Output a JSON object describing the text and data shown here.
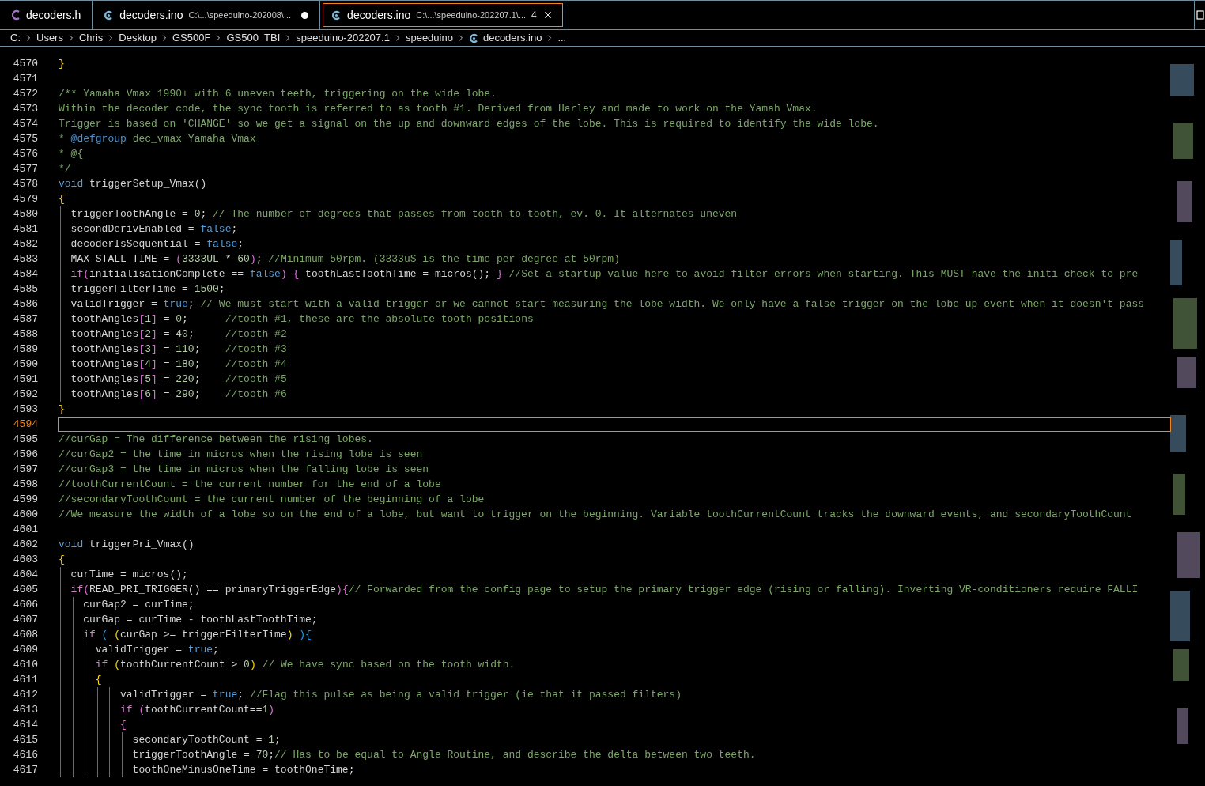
{
  "tabs": [
    {
      "filename": "decoders.h",
      "kind": "header",
      "modified": false,
      "selected": false
    },
    {
      "filename": "decoders.ino",
      "path": "C:\\...\\speeduino-202008\\...",
      "kind": "source",
      "modified": true,
      "selected": false
    },
    {
      "filename": "decoders.ino",
      "path": "C:\\...\\speeduino-202207.1\\...",
      "kind": "source",
      "badge": "4",
      "modified": false,
      "selected": true
    }
  ],
  "breadcrumb": [
    {
      "label": "C:"
    },
    {
      "label": "Users"
    },
    {
      "label": "Chris"
    },
    {
      "label": "Desktop"
    },
    {
      "label": "GS500F"
    },
    {
      "label": "GS500_TBI"
    },
    {
      "label": "speeduino-202207.1"
    },
    {
      "label": "speeduino"
    },
    {
      "label": "decoders.ino",
      "kind": "file"
    },
    {
      "label": "..."
    }
  ],
  "lines": [
    {
      "number": "4570",
      "current": false,
      "tokens": [
        {
          "kind": "bracket1",
          "text": "}"
        }
      ]
    },
    {
      "number": "4571",
      "current": false
    },
    {
      "number": "4572",
      "current": false,
      "tokens": [
        {
          "kind": "comment",
          "text": "/** Yamaha Vmax 1990+ with 6 uneven teeth, triggering on the wide lobe."
        }
      ]
    },
    {
      "number": "4573",
      "current": false,
      "tokens": [
        {
          "kind": "comment",
          "text": "Within the decoder code, the sync tooth is referred to as tooth #1. Derived from Harley and made to work on the Yamah Vmax."
        }
      ]
    },
    {
      "number": "4574",
      "current": false,
      "tokens": [
        {
          "kind": "comment",
          "text": "Trigger is based on 'CHANGE' so we get a signal on the up and downward edges of the lobe. This is required to identify the wide lobe."
        }
      ]
    },
    {
      "number": "4575",
      "current": false,
      "tokens": [
        {
          "kind": "comment",
          "text": "* "
        },
        {
          "kind": "tag",
          "text": "@defgroup"
        },
        {
          "kind": "comment",
          "text": " dec_vmax Yamaha Vmax"
        }
      ]
    },
    {
      "number": "4576",
      "current": false,
      "tokens": [
        {
          "kind": "comment",
          "text": "* @{"
        }
      ]
    },
    {
      "number": "4577",
      "current": false,
      "tokens": [
        {
          "kind": "comment",
          "text": "*/"
        }
      ]
    },
    {
      "number": "4578",
      "current": false,
      "tokens": [
        {
          "kind": "keyword",
          "text": "void"
        },
        {
          "kind": "plain",
          "text": " triggerSetup_Vmax()"
        }
      ]
    },
    {
      "number": "4579",
      "current": false,
      "tokens": [
        {
          "kind": "bracket1",
          "text": "{"
        }
      ]
    },
    {
      "number": "4580",
      "current": false,
      "tokens": [
        {
          "kind": "plain",
          "text": "  triggerToothAngle = "
        },
        {
          "kind": "number",
          "text": "0"
        },
        {
          "kind": "plain",
          "text": "; "
        },
        {
          "kind": "comment",
          "text": "// The number of degrees that passes from tooth to tooth, ev. 0. It alternates uneven"
        }
      ]
    },
    {
      "number": "4581",
      "current": false,
      "tokens": [
        {
          "kind": "plain",
          "text": "  secondDerivEnabled = "
        },
        {
          "kind": "keyword",
          "text": "false"
        },
        {
          "kind": "plain",
          "text": ";"
        }
      ]
    },
    {
      "number": "4582",
      "current": false,
      "tokens": [
        {
          "kind": "plain",
          "text": "  decoderIsSequential = "
        },
        {
          "kind": "keyword",
          "text": "false"
        },
        {
          "kind": "plain",
          "text": ";"
        }
      ]
    },
    {
      "number": "4583",
      "current": false,
      "tokens": [
        {
          "kind": "plain",
          "text": "  MAX_STALL_TIME = "
        },
        {
          "kind": "bracket2",
          "text": "("
        },
        {
          "kind": "number",
          "text": "3333UL"
        },
        {
          "kind": "plain",
          "text": " * "
        },
        {
          "kind": "number",
          "text": "60"
        },
        {
          "kind": "bracket2",
          "text": ")"
        },
        {
          "kind": "plain",
          "text": "; "
        },
        {
          "kind": "comment",
          "text": "//Minimum 50rpm. (3333uS is the time per degree at 50rpm)"
        }
      ]
    },
    {
      "number": "4584",
      "current": false,
      "tokens": [
        {
          "kind": "control",
          "text": "  if"
        },
        {
          "kind": "bracket2",
          "text": "("
        },
        {
          "kind": "plain",
          "text": "initialisationComplete == "
        },
        {
          "kind": "keyword",
          "text": "false"
        },
        {
          "kind": "bracket2",
          "text": ") {"
        },
        {
          "kind": "plain",
          "text": " toothLastToothTime = micros(); "
        },
        {
          "kind": "bracket2",
          "text": "} "
        },
        {
          "kind": "comment",
          "text": "//Set a startup value here to avoid filter errors when starting. This MUST have the initi check to pre"
        }
      ]
    },
    {
      "number": "4585",
      "current": false,
      "tokens": [
        {
          "kind": "plain",
          "text": "  triggerFilterTime = "
        },
        {
          "kind": "number",
          "text": "1500"
        },
        {
          "kind": "plain",
          "text": ";"
        }
      ]
    },
    {
      "number": "4586",
      "current": false,
      "tokens": [
        {
          "kind": "plain",
          "text": "  validTrigger = "
        },
        {
          "kind": "keyword",
          "text": "true"
        },
        {
          "kind": "plain",
          "text": "; "
        },
        {
          "kind": "comment",
          "text": "// We must start with a valid trigger or we cannot start measuring the lobe width. We only have a false trigger on the lobe up event when it doesn't pass"
        }
      ]
    },
    {
      "number": "4587",
      "current": false,
      "tokens": [
        {
          "kind": "plain",
          "text": "  toothAngles"
        },
        {
          "kind": "bracket2",
          "text": "["
        },
        {
          "kind": "number",
          "text": "1"
        },
        {
          "kind": "bracket2",
          "text": "]"
        },
        {
          "kind": "plain",
          "text": " = "
        },
        {
          "kind": "number",
          "text": "0"
        },
        {
          "kind": "plain",
          "text": ";      "
        },
        {
          "kind": "comment",
          "text": "//tooth #1, these are the absolute tooth positions"
        }
      ]
    },
    {
      "number": "4588",
      "current": false,
      "tokens": [
        {
          "kind": "plain",
          "text": "  toothAngles"
        },
        {
          "kind": "bracket2",
          "text": "["
        },
        {
          "kind": "number",
          "text": "2"
        },
        {
          "kind": "bracket2",
          "text": "]"
        },
        {
          "kind": "plain",
          "text": " = "
        },
        {
          "kind": "number",
          "text": "40"
        },
        {
          "kind": "plain",
          "text": ";     "
        },
        {
          "kind": "comment",
          "text": "//tooth #2"
        }
      ]
    },
    {
      "number": "4589",
      "current": false,
      "tokens": [
        {
          "kind": "plain",
          "text": "  toothAngles"
        },
        {
          "kind": "bracket2",
          "text": "["
        },
        {
          "kind": "number",
          "text": "3"
        },
        {
          "kind": "bracket2",
          "text": "]"
        },
        {
          "kind": "plain",
          "text": " = "
        },
        {
          "kind": "number",
          "text": "110"
        },
        {
          "kind": "plain",
          "text": ";    "
        },
        {
          "kind": "comment",
          "text": "//tooth #3"
        }
      ]
    },
    {
      "number": "4590",
      "current": false,
      "tokens": [
        {
          "kind": "plain",
          "text": "  toothAngles"
        },
        {
          "kind": "bracket2",
          "text": "["
        },
        {
          "kind": "number",
          "text": "4"
        },
        {
          "kind": "bracket2",
          "text": "]"
        },
        {
          "kind": "plain",
          "text": " = "
        },
        {
          "kind": "number",
          "text": "180"
        },
        {
          "kind": "plain",
          "text": ";    "
        },
        {
          "kind": "comment",
          "text": "//tooth #4"
        }
      ]
    },
    {
      "number": "4591",
      "current": false,
      "tokens": [
        {
          "kind": "plain",
          "text": "  toothAngles"
        },
        {
          "kind": "bracket2",
          "text": "["
        },
        {
          "kind": "number",
          "text": "5"
        },
        {
          "kind": "bracket2",
          "text": "]"
        },
        {
          "kind": "plain",
          "text": " = "
        },
        {
          "kind": "number",
          "text": "220"
        },
        {
          "kind": "plain",
          "text": ";    "
        },
        {
          "kind": "comment",
          "text": "//tooth #5"
        }
      ]
    },
    {
      "number": "4592",
      "current": false,
      "tokens": [
        {
          "kind": "plain",
          "text": "  toothAngles"
        },
        {
          "kind": "bracket2",
          "text": "["
        },
        {
          "kind": "number",
          "text": "6"
        },
        {
          "kind": "bracket2",
          "text": "]"
        },
        {
          "kind": "plain",
          "text": " = "
        },
        {
          "kind": "number",
          "text": "290"
        },
        {
          "kind": "plain",
          "text": ";    "
        },
        {
          "kind": "comment",
          "text": "//tooth #6"
        }
      ]
    },
    {
      "number": "4593",
      "current": false,
      "tokens": [
        {
          "kind": "bracket1",
          "text": "}"
        }
      ]
    },
    {
      "number": "4594",
      "current": true
    },
    {
      "number": "4595",
      "current": false,
      "tokens": [
        {
          "kind": "comment",
          "text": "//curGap = The difference between the rising lobes."
        }
      ]
    },
    {
      "number": "4596",
      "current": false,
      "tokens": [
        {
          "kind": "comment",
          "text": "//curGap2 = the time in micros when the rising lobe is seen"
        }
      ]
    },
    {
      "number": "4597",
      "current": false,
      "tokens": [
        {
          "kind": "comment",
          "text": "//curGap3 = the time in micros when the falling lobe is seen"
        }
      ]
    },
    {
      "number": "4598",
      "current": false,
      "tokens": [
        {
          "kind": "comment",
          "text": "//toothCurrentCount = the current number for the end of a lobe"
        }
      ]
    },
    {
      "number": "4599",
      "current": false,
      "tokens": [
        {
          "kind": "comment",
          "text": "//secondaryToothCount = the current number of the beginning of a lobe"
        }
      ]
    },
    {
      "number": "4600",
      "current": false,
      "tokens": [
        {
          "kind": "comment",
          "text": "//We measure the width of a lobe so on the end of a lobe, but want to trigger on the beginning. Variable toothCurrentCount tracks the downward events, and secondaryToothCount"
        }
      ]
    },
    {
      "number": "4601",
      "current": false
    },
    {
      "number": "4602",
      "current": false,
      "tokens": [
        {
          "kind": "keyword",
          "text": "void"
        },
        {
          "kind": "plain",
          "text": " triggerPri_Vmax()"
        }
      ]
    },
    {
      "number": "4603",
      "current": false,
      "tokens": [
        {
          "kind": "bracket1",
          "text": "{"
        }
      ]
    },
    {
      "number": "4604",
      "current": false,
      "tokens": [
        {
          "kind": "plain",
          "text": "  curTime = micros();"
        }
      ]
    },
    {
      "number": "4605",
      "current": false,
      "tokens": [
        {
          "kind": "control",
          "text": "  if"
        },
        {
          "kind": "bracket2",
          "text": "("
        },
        {
          "kind": "plain",
          "text": "READ_PRI_TRIGGER() == primaryTriggerEdge"
        },
        {
          "kind": "bracket2",
          "text": "){"
        },
        {
          "kind": "comment",
          "text": "// Forwarded from the config page to setup the primary trigger edge (rising or falling). Inverting VR-conditioners require FALLI"
        }
      ]
    },
    {
      "number": "4606",
      "current": false,
      "tokens": [
        {
          "kind": "plain",
          "text": "    curGap2 = curTime;"
        }
      ]
    },
    {
      "number": "4607",
      "current": false,
      "tokens": [
        {
          "kind": "plain",
          "text": "    curGap = curTime - toothLastToothTime;"
        }
      ]
    },
    {
      "number": "4608",
      "current": false,
      "tokens": [
        {
          "kind": "control",
          "text": "    if "
        },
        {
          "kind": "bracket3",
          "text": "( "
        },
        {
          "kind": "bracket1",
          "text": "("
        },
        {
          "kind": "plain",
          "text": "curGap >= triggerFilterTime"
        },
        {
          "kind": "bracket1",
          "text": ") "
        },
        {
          "kind": "bracket3",
          "text": "){"
        }
      ]
    },
    {
      "number": "4609",
      "current": false,
      "tokens": [
        {
          "kind": "plain",
          "text": "      validTrigger = "
        },
        {
          "kind": "keyword",
          "text": "true"
        },
        {
          "kind": "plain",
          "text": ";"
        }
      ]
    },
    {
      "number": "4610",
      "current": false,
      "tokens": [
        {
          "kind": "control",
          "text": "      if "
        },
        {
          "kind": "bracket1",
          "text": "("
        },
        {
          "kind": "plain",
          "text": "toothCurrentCount > "
        },
        {
          "kind": "number",
          "text": "0"
        },
        {
          "kind": "bracket1",
          "text": ") "
        },
        {
          "kind": "comment",
          "text": "// We have sync based on the tooth width."
        }
      ]
    },
    {
      "number": "4611",
      "current": false,
      "tokens": [
        {
          "kind": "bracket1",
          "text": "      {"
        }
      ]
    },
    {
      "number": "4612",
      "current": false,
      "tokens": [
        {
          "kind": "plain",
          "text": "          validTrigger = "
        },
        {
          "kind": "keyword",
          "text": "true"
        },
        {
          "kind": "plain",
          "text": "; "
        },
        {
          "kind": "comment",
          "text": "//Flag this pulse as being a valid trigger (ie that it passed filters)"
        }
      ]
    },
    {
      "number": "4613",
      "current": false,
      "tokens": [
        {
          "kind": "control",
          "text": "          if "
        },
        {
          "kind": "bracket2",
          "text": "("
        },
        {
          "kind": "plain",
          "text": "toothCurrentCount=="
        },
        {
          "kind": "number",
          "text": "1"
        },
        {
          "kind": "bracket2",
          "text": ")"
        }
      ]
    },
    {
      "number": "4614",
      "current": false,
      "tokens": [
        {
          "kind": "bracket2",
          "text": "          {"
        }
      ]
    },
    {
      "number": "4615",
      "current": false,
      "tokens": [
        {
          "kind": "plain",
          "text": "            secondaryToothCount = "
        },
        {
          "kind": "number",
          "text": "1"
        },
        {
          "kind": "plain",
          "text": ";"
        }
      ]
    },
    {
      "number": "4616",
      "current": false,
      "tokens": [
        {
          "kind": "plain",
          "text": "            triggerToothAngle = "
        },
        {
          "kind": "number",
          "text": "70"
        },
        {
          "kind": "plain",
          "text": ";"
        },
        {
          "kind": "comment",
          "text": "// Has to be equal to Angle Routine, and describe the delta between two teeth."
        }
      ]
    },
    {
      "number": "4617",
      "current": false,
      "tokens": [
        {
          "kind": "plain",
          "text": "            toothOneMinusOneTime = toothOneTime;"
        }
      ]
    }
  ]
}
